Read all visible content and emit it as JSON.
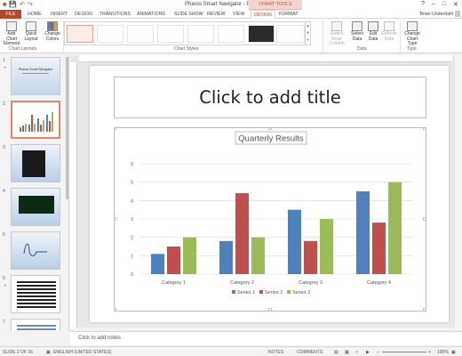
{
  "titlebar": {
    "title": "Pharos Smart Navigator - PowerPoint",
    "chart_tools": "CHART TOOLS"
  },
  "tabs": [
    {
      "label": "FILE"
    },
    {
      "label": "HOME"
    },
    {
      "label": "INSERT"
    },
    {
      "label": "DESIGN"
    },
    {
      "label": "TRANSITIONS"
    },
    {
      "label": "ANIMATIONS"
    },
    {
      "label": "SLIDE SHOW"
    },
    {
      "label": "REVIEW"
    },
    {
      "label": "VIEW"
    },
    {
      "label": "DESIGN"
    },
    {
      "label": "FORMAT"
    }
  ],
  "user": {
    "name": "Brian Underdahl"
  },
  "ribbon": {
    "add_chart_element": "Add Chart Element",
    "quick_layout": "Quick Layout",
    "change_colors": "Change Colors",
    "switch_row_column": "Switch Row/ Column",
    "select_data": "Select Data",
    "edit_data": "Edit Data",
    "refresh_data": "Refresh Data",
    "change_chart_type": "Change Chart Type",
    "groups": {
      "layouts": "Chart Layouts",
      "styles": "Chart Styles",
      "data": "Data",
      "type": "Type"
    }
  },
  "slides": [
    {
      "num": "1",
      "title": "Pharos Smart Navigator"
    },
    {
      "num": "2"
    },
    {
      "num": "3"
    },
    {
      "num": "4"
    },
    {
      "num": "5"
    },
    {
      "num": "6"
    },
    {
      "num": "7"
    }
  ],
  "slide": {
    "title_placeholder": "Click to add title"
  },
  "notes": {
    "placeholder": "Click to add notes"
  },
  "status": {
    "slide": "SLIDE 2 OF 16",
    "language": "ENGLISH (UNITED STATES)",
    "notes": "NOTES",
    "comments": "COMMENTS",
    "zoom": "100%"
  },
  "colors": {
    "accent": "#b7472a",
    "series1": "#4f81bd",
    "series2": "#c0504d",
    "series3": "#9bbb59"
  },
  "chart_data": {
    "type": "bar",
    "title": "Quarterly Results",
    "categories": [
      "Category 1",
      "Category 2",
      "Category 3",
      "Category 4"
    ],
    "series": [
      {
        "name": "Series 1",
        "values": [
          1.1,
          1.8,
          3.5,
          4.5
        ]
      },
      {
        "name": "Series 2",
        "values": [
          1.5,
          4.4,
          1.8,
          2.8
        ]
      },
      {
        "name": "Series 3",
        "values": [
          2,
          2,
          3,
          5
        ]
      }
    ],
    "ylim": [
      0,
      6
    ],
    "yticks": [
      0,
      1,
      2,
      3,
      4,
      5,
      6
    ],
    "grid": true,
    "legend": "bottom"
  }
}
